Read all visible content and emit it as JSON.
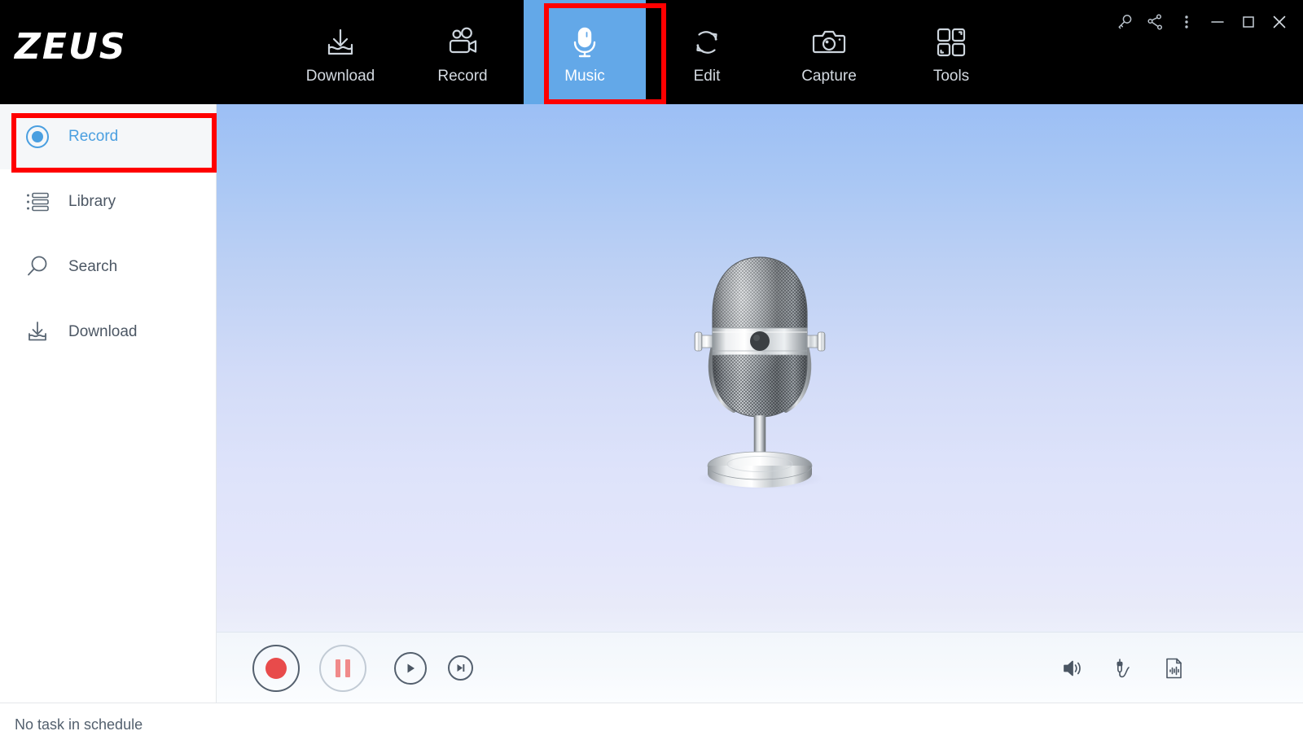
{
  "app": {
    "logo_text": "ZEUS",
    "accent_blue": "#63a8e8",
    "annotation_red": "#ff0000",
    "toolbar_bg": "#000000"
  },
  "toolbar": {
    "tabs": [
      {
        "label": "Download",
        "icon": "download-tray-icon",
        "active": false
      },
      {
        "label": "Record",
        "icon": "video-camera-icon",
        "active": false
      },
      {
        "label": "Music",
        "icon": "microphone-icon",
        "active": true
      },
      {
        "label": "Edit",
        "icon": "convert-refresh-icon",
        "active": false
      },
      {
        "label": "Capture",
        "icon": "camera-icon",
        "active": false
      },
      {
        "label": "Tools",
        "icon": "grid-squares-icon",
        "active": false
      }
    ]
  },
  "window_controls": [
    {
      "name": "key-icon",
      "title": "Key"
    },
    {
      "name": "share-icon",
      "title": "Share"
    },
    {
      "name": "more-menu-icon",
      "title": "More"
    },
    {
      "name": "minimize-icon",
      "title": "Minimize"
    },
    {
      "name": "maximize-icon",
      "title": "Maximize"
    },
    {
      "name": "close-icon",
      "title": "Close"
    }
  ],
  "sidebar": {
    "items": [
      {
        "label": "Record",
        "icon": "record-radio-icon",
        "active": true
      },
      {
        "label": "Library",
        "icon": "list-icon",
        "active": false
      },
      {
        "label": "Search",
        "icon": "magnifier-icon",
        "active": false
      },
      {
        "label": "Download",
        "icon": "download-tray-icon",
        "active": false
      }
    ]
  },
  "stage": {
    "artwork": "vintage-microphone-illustration",
    "bg_top": "#9cbff5",
    "bg_bottom": "#eceffb"
  },
  "controls": {
    "transport": [
      {
        "name": "record-button",
        "label": "Record",
        "state": "enabled"
      },
      {
        "name": "pause-button",
        "label": "Pause",
        "state": "disabled"
      },
      {
        "name": "play-button",
        "label": "Play",
        "state": "enabled"
      },
      {
        "name": "next-button",
        "label": "Next",
        "state": "enabled"
      }
    ],
    "right_icons": [
      {
        "name": "volume-icon",
        "label": "Volume"
      },
      {
        "name": "audio-jack-icon",
        "label": "Audio Input"
      },
      {
        "name": "waveform-file-icon",
        "label": "Audio File"
      }
    ]
  },
  "statusbar": {
    "text": "No task in schedule"
  }
}
